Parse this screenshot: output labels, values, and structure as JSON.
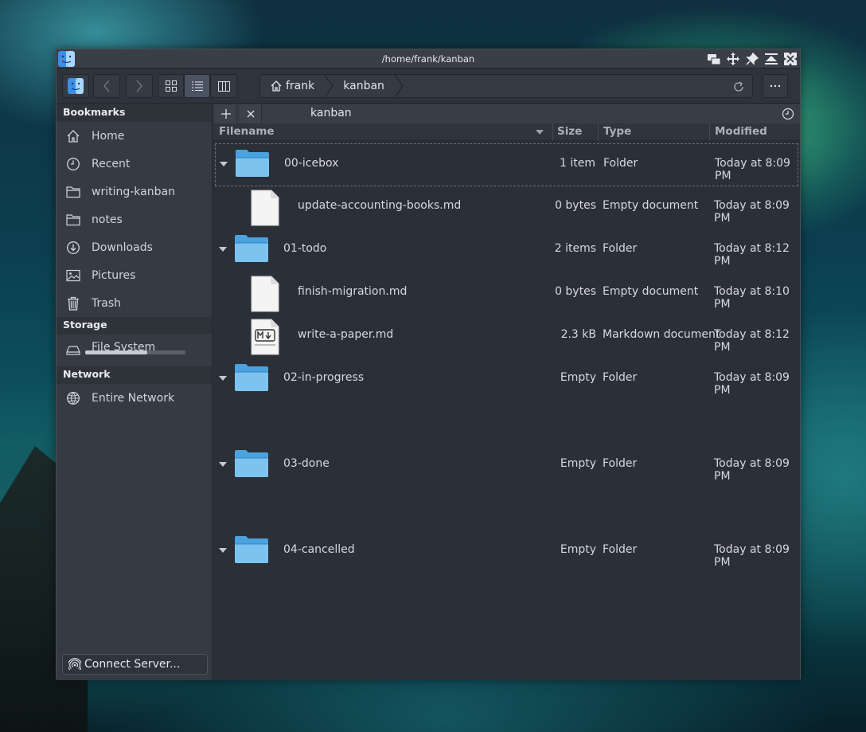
{
  "window": {
    "title": "/home/frank/kanban"
  },
  "breadcrumb": {
    "items": [
      "frank",
      "kanban"
    ]
  },
  "sidebar": {
    "sections": [
      {
        "header": "Bookmarks",
        "items": [
          {
            "label": "Home",
            "icon": "home-icon"
          },
          {
            "label": "Recent",
            "icon": "clock-icon"
          },
          {
            "label": "writing-kanban",
            "icon": "folder-icon"
          },
          {
            "label": "notes",
            "icon": "folder-icon"
          },
          {
            "label": "Downloads",
            "icon": "download-icon"
          },
          {
            "label": "Pictures",
            "icon": "picture-icon"
          },
          {
            "label": "Trash",
            "icon": "trash-icon"
          }
        ]
      },
      {
        "header": "Storage",
        "items": [
          {
            "label": "File System",
            "icon": "drive-icon",
            "usage_fraction": 0.62
          }
        ]
      },
      {
        "header": "Network",
        "items": [
          {
            "label": "Entire Network",
            "icon": "network-icon"
          }
        ]
      }
    ],
    "connect_label": "Connect Server..."
  },
  "tab": {
    "label": "kanban"
  },
  "columns": {
    "filename": "Filename",
    "size": "Size",
    "type": "Type",
    "modified": "Modified"
  },
  "files": [
    {
      "name": "00-icebox",
      "size": "1 item",
      "type": "Folder",
      "modified": "Today at 8:09 PM",
      "kind": "folder",
      "level": 0,
      "selected": true
    },
    {
      "name": "update-accounting-books.md",
      "size": "0 bytes",
      "type": "Empty document",
      "modified": "Today at 8:09 PM",
      "kind": "document",
      "level": 1
    },
    {
      "name": "01-todo",
      "size": "2 items",
      "type": "Folder",
      "modified": "Today at 8:12 PM",
      "kind": "folder",
      "level": 0
    },
    {
      "name": "finish-migration.md",
      "size": "0 bytes",
      "type": "Empty document",
      "modified": "Today at 8:10 PM",
      "kind": "document",
      "level": 1
    },
    {
      "name": "write-a-paper.md",
      "size": "2.3 kB",
      "type": "Markdown document",
      "modified": "Today at 8:12 PM",
      "kind": "markdown",
      "level": 1
    },
    {
      "name": "02-in-progress",
      "size": "Empty",
      "type": "Folder",
      "modified": "Today at 8:09 PM",
      "kind": "folder",
      "level": 0
    },
    {
      "name": "03-done",
      "size": "Empty",
      "type": "Folder",
      "modified": "Today at 8:09 PM",
      "kind": "folder",
      "level": 0
    },
    {
      "name": "04-cancelled",
      "size": "Empty",
      "type": "Folder",
      "modified": "Today at 8:09 PM",
      "kind": "folder",
      "level": 0
    }
  ],
  "colors": {
    "folder": "#4aa3df",
    "folder_light": "#7cc3ef",
    "accent": "#4a5262"
  }
}
